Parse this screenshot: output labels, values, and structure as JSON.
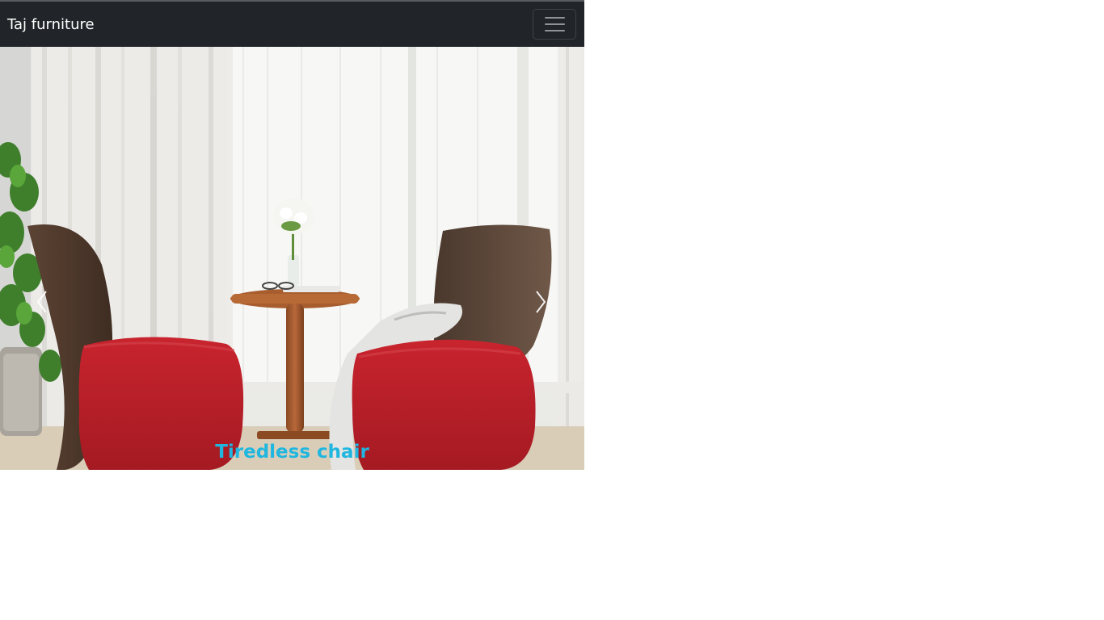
{
  "navbar": {
    "brand": "Taj furniture",
    "toggler_icon": "hamburger-icon",
    "background": "#212529"
  },
  "carousel": {
    "slide": {
      "caption": "Tiredless chair",
      "caption_color": "#1fb6e0"
    },
    "prev_icon": "chevron-left-icon",
    "next_icon": "chevron-right-icon"
  }
}
